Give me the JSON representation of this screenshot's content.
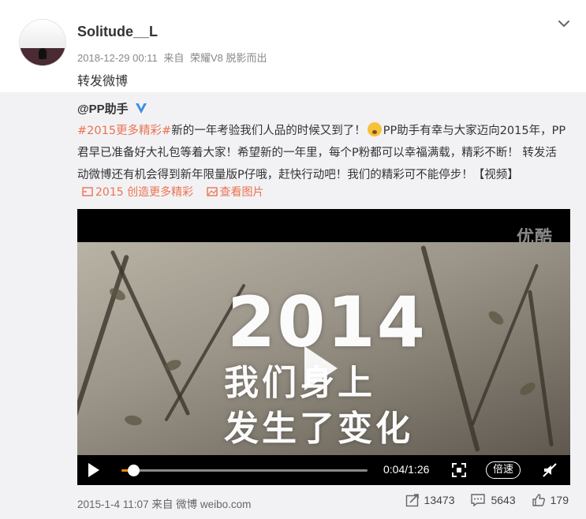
{
  "post": {
    "username": "Solitude__L",
    "timestamp": "2018-12-29 00:11",
    "source_prefix": "来自",
    "source_device": "荣耀V8 脱影而出",
    "repost_text": "转发微博"
  },
  "original": {
    "username": "@PP助手",
    "body": {
      "hashtag": "#2015更多精彩#",
      "text_a": "新的一年考验我们人品的时候又到了！",
      "text_b": "PP助手有幸与大家迈向2015年，PP君早已准备好大礼包等着大家！希望新的一年里，每个P粉都可以幸福满载，精彩不断！ 转发活动微博还有机会得到新年限量版P仔哦，赶快行动吧！我们的精彩可不能停步！【视频】"
    },
    "links": {
      "topic": "2015 创造更多精彩",
      "image": "查看图片"
    },
    "video": {
      "watermark": "优酷",
      "frame_year": "2014",
      "frame_line1": "我们身上",
      "frame_line2": "发生了变化",
      "time": "0:04/1:26",
      "progress": 0.048,
      "speed_label": "倍速"
    },
    "footer": {
      "date": "2015-1-4 11:07",
      "source_prefix": "来自",
      "source": "微博 weibo.com",
      "reposts": "13473",
      "comments": "5643",
      "likes": "179"
    }
  },
  "colors": {
    "accent": "#eb7350",
    "verified": "#3a8ee6",
    "progress": "#ff8200",
    "forward_bg": "#f2f2f5"
  }
}
